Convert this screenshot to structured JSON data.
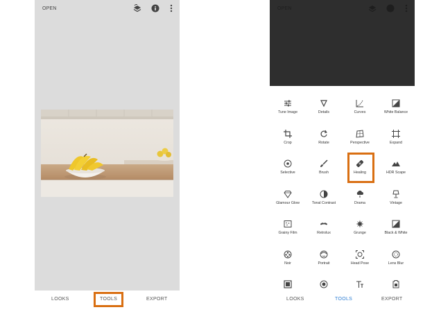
{
  "left_screen": {
    "top_bar": {
      "open_label": "OPEN",
      "icons": [
        "layers-undo-icon",
        "info-icon",
        "more-vert-icon"
      ]
    },
    "bottom_tabs": [
      {
        "label": "LOOKS",
        "active": false
      },
      {
        "label": "TOOLS",
        "active": true,
        "highlighted": true
      },
      {
        "label": "EXPORT",
        "active": false
      }
    ],
    "photo": {
      "subject": "bananas-in-bowl-kitchen-image"
    }
  },
  "right_screen": {
    "top_bar": {
      "open_label": "OPEN"
    },
    "tools": [
      {
        "label": "Tune Image",
        "icon": "sliders-icon"
      },
      {
        "label": "Details",
        "icon": "triangle-down-icon"
      },
      {
        "label": "Curves",
        "icon": "curves-icon"
      },
      {
        "label": "White Balance",
        "icon": "white-balance-icon"
      },
      {
        "label": "Crop",
        "icon": "crop-icon"
      },
      {
        "label": "Rotate",
        "icon": "rotate-icon"
      },
      {
        "label": "Perspective",
        "icon": "perspective-icon"
      },
      {
        "label": "Expand",
        "icon": "expand-icon"
      },
      {
        "label": "Selective",
        "icon": "target-icon"
      },
      {
        "label": "Brush",
        "icon": "brush-icon"
      },
      {
        "label": "Healing",
        "icon": "bandage-icon",
        "highlighted": true
      },
      {
        "label": "HDR Scape",
        "icon": "mountain-icon"
      },
      {
        "label": "Glamour Glow",
        "icon": "diamond-icon"
      },
      {
        "label": "Tonal Contrast",
        "icon": "half-circle-icon"
      },
      {
        "label": "Drama",
        "icon": "cloud-rain-icon"
      },
      {
        "label": "Vintage",
        "icon": "lamp-icon"
      },
      {
        "label": "Grainy Film",
        "icon": "film-grain-icon"
      },
      {
        "label": "Retrolux",
        "icon": "mustache-icon"
      },
      {
        "label": "Grunge",
        "icon": "grunge-icon"
      },
      {
        "label": "Black & White",
        "icon": "black-white-icon"
      },
      {
        "label": "Noir",
        "icon": "film-reel-icon"
      },
      {
        "label": "Portrait",
        "icon": "face-icon"
      },
      {
        "label": "Head Pose",
        "icon": "head-pose-icon"
      },
      {
        "label": "Lens Blur",
        "icon": "lens-blur-icon"
      },
      {
        "label": "",
        "icon": "frame-icon"
      },
      {
        "label": "",
        "icon": "double-exposure-icon"
      },
      {
        "label": "",
        "icon": "text-icon"
      },
      {
        "label": "",
        "icon": "stamp-icon"
      }
    ],
    "bottom_tabs": [
      {
        "label": "LOOKS",
        "active": false
      },
      {
        "label": "TOOLS",
        "active": true
      },
      {
        "label": "EXPORT",
        "active": false
      }
    ]
  },
  "colors": {
    "highlight": "#d96f12",
    "active_tab": "#2f7fd4",
    "editor_bg": "#dcdcdc",
    "preview_dark": "#2e2e2e"
  }
}
